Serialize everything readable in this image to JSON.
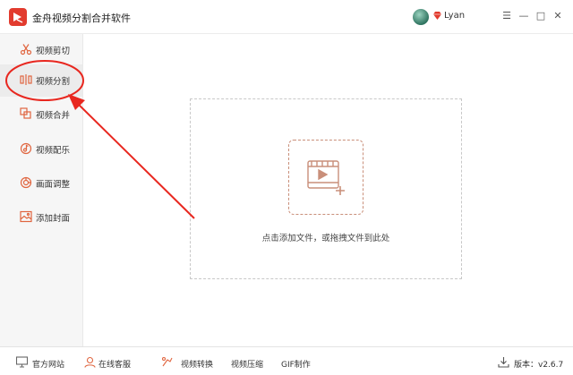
{
  "app": {
    "title": "金舟视频分割合并软件",
    "username": "Lyan",
    "accent_color": "#e23b2e"
  },
  "window_controls": {
    "menu": "☰",
    "minimize": "—",
    "maximize": "□",
    "close": "✕"
  },
  "sidebar": {
    "items": [
      {
        "label": "视频剪切",
        "icon": "scissors-icon",
        "active": false
      },
      {
        "label": "视频分割",
        "icon": "split-icon",
        "active": true
      },
      {
        "label": "视频合并",
        "icon": "merge-icon",
        "active": false
      },
      {
        "label": "视频配乐",
        "icon": "music-icon",
        "active": false
      },
      {
        "label": "画面调整",
        "icon": "adjust-icon",
        "active": false
      },
      {
        "label": "添加封面",
        "icon": "image-icon",
        "active": false
      }
    ]
  },
  "dropzone": {
    "hint": "点击添加文件，或拖拽文件到此处",
    "icon": "add-video-icon"
  },
  "bottombar": {
    "items": [
      {
        "label": "官方网站",
        "icon": "monitor-icon"
      },
      {
        "label": "在线客服",
        "icon": "support-icon"
      },
      {
        "label": "视频转换",
        "icon": "convert-icon"
      },
      {
        "label": "视频压缩",
        "icon": ""
      },
      {
        "label": "GIF制作",
        "icon": ""
      }
    ],
    "version": "版本：v2.6.7"
  }
}
